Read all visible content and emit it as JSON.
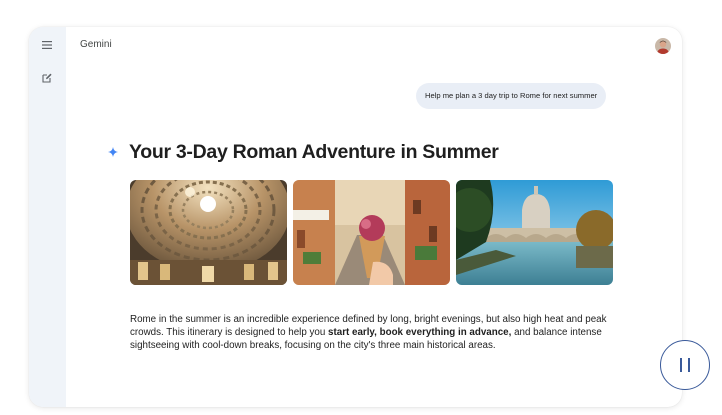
{
  "app": {
    "title": "Gemini"
  },
  "sidebar": {
    "menu_icon": "hamburger-menu-icon",
    "new_chat_icon": "edit-square-icon"
  },
  "conversation": {
    "user_message": "Help me plan a 3 day trip to Rome for next summer",
    "response": {
      "title": "Your 3-Day Roman Adventure in Summer",
      "images": [
        {
          "subject": "pantheon-dome-interior"
        },
        {
          "subject": "gelato-cone-on-rome-street"
        },
        {
          "subject": "tiber-river-st-peters-basilica"
        }
      ],
      "paragraph": {
        "part1": "Rome in the summer is an incredible experience defined by long, bright evenings, but also high heat and peak crowds. This itinerary is designed to help you ",
        "bold": "start early, book everything in advance,",
        "part2": " and balance intense sightseeing with cool-down breaks, focusing on the city's three main historical areas."
      }
    }
  },
  "controls": {
    "pause_icon": "pause-icon"
  },
  "colors": {
    "sidebar_bg": "#f0f4f9",
    "user_bubble_bg": "#e9eef6",
    "text": "#1f1f1f",
    "accent_blue": "#4285f4",
    "pause_border": "#3a5a9a"
  }
}
